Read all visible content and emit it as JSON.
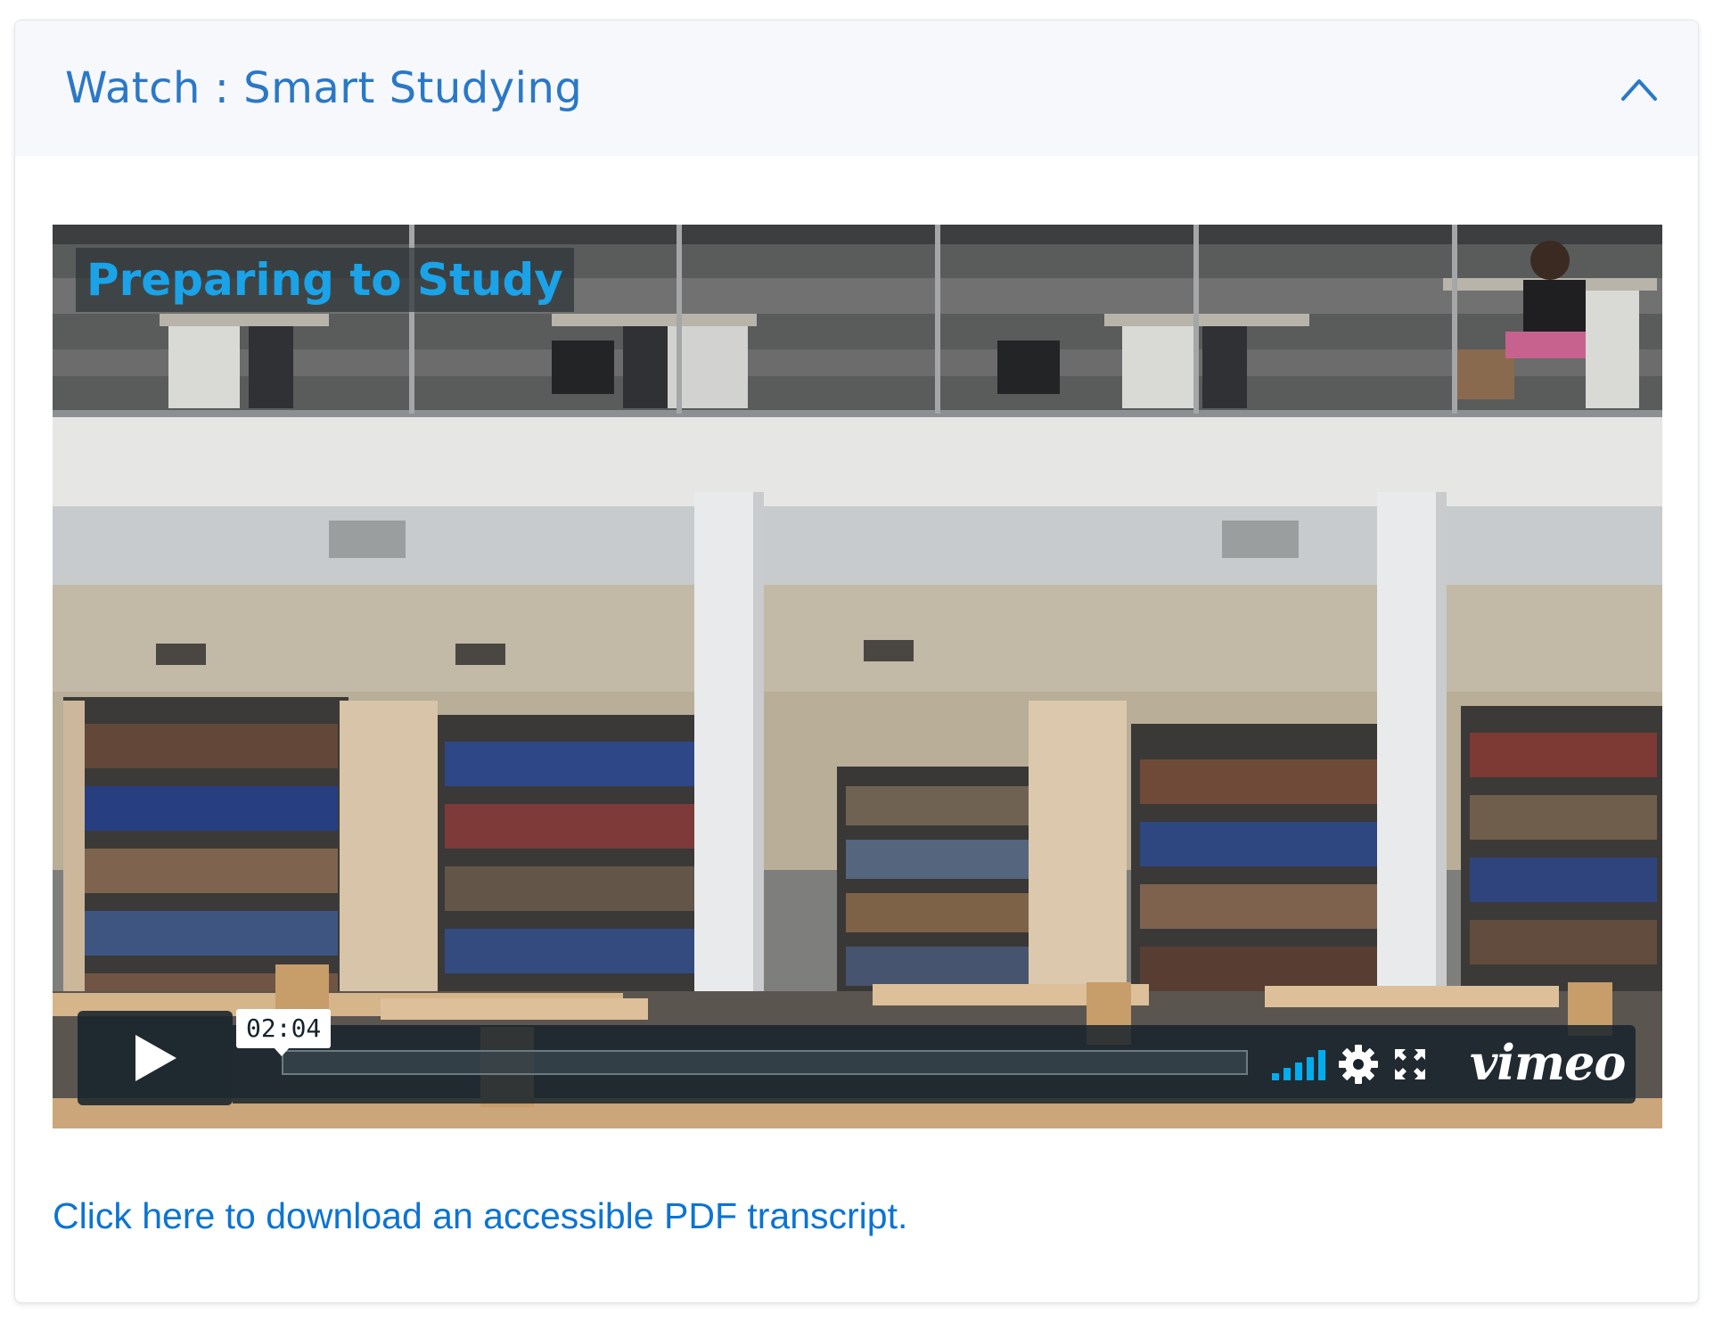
{
  "section": {
    "title": "Watch : Smart Studying",
    "toggle_icon": "chevron-up-icon",
    "expanded": true
  },
  "video": {
    "caption": "Preparing to Study",
    "current_time": "02:04",
    "brand": "vimeo",
    "icons": {
      "play": "play-icon",
      "volume": "volume-icon",
      "settings": "gear-icon",
      "fullscreen": "fullscreen-icon"
    },
    "colors": {
      "caption_text": "#1aa3e8",
      "controls_bg": "#17232b",
      "volume_bars": "#00adef"
    }
  },
  "transcript": {
    "link_text": "Click here to download an accessible PDF transcript."
  },
  "colors": {
    "accent": "#2b78c6",
    "link": "#0c74d3",
    "header_bg": "#f6f8fb"
  }
}
